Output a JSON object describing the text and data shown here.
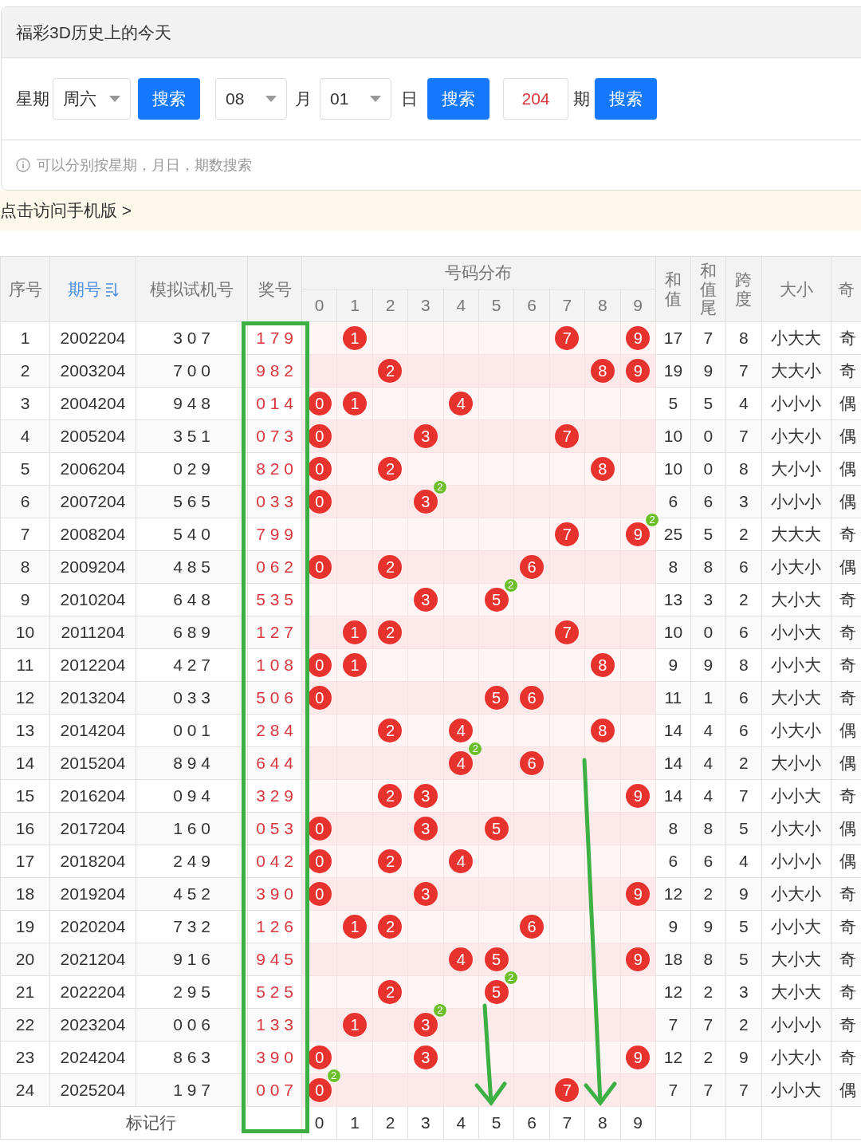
{
  "page_title": "福彩3D历史上的今天",
  "search": {
    "weekday_label": "星期",
    "weekday": "周六",
    "weekday_button": "搜索",
    "month": "08",
    "month_label": "月",
    "day": "01",
    "day_label": "日",
    "date_button": "搜索",
    "issue": "204",
    "issue_label": "期",
    "issue_button": "搜索"
  },
  "hint": "可以分别按星期，月日，期数搜索",
  "mobile_link": "点击访问手机版 >",
  "table": {
    "columns": [
      {
        "label": "序号",
        "sorted": false
      },
      {
        "label": "期号",
        "sorted": true
      },
      {
        "label": "模拟试机号",
        "sorted": false
      },
      {
        "label": "奖号",
        "sorted": false
      }
    ],
    "distribution_title": "号码分布",
    "distribution_columns": [
      "0",
      "1",
      "2",
      "3",
      "4",
      "5",
      "6",
      "7",
      "8",
      "9"
    ],
    "stat_columns": [
      {
        "label": "和值",
        "kind": "stacked"
      },
      {
        "label": "和值尾",
        "kind": "stacked"
      },
      {
        "label": "跨度",
        "kind": "stacked"
      },
      {
        "label": "大小",
        "kind": "plain"
      },
      {
        "label": "奇",
        "kind": "plain"
      }
    ],
    "rows": [
      {
        "seq": "1",
        "issue": "2002204",
        "test": "3 0 7",
        "prize": "1 7 9",
        "cells": [
          null,
          {
            "digit": "1"
          },
          null,
          null,
          null,
          null,
          null,
          {
            "digit": "7"
          },
          null,
          {
            "digit": "9"
          }
        ],
        "sum": "17",
        "sum_tail": "7",
        "span": "8",
        "size": "小大大",
        "parity": "奇"
      },
      {
        "seq": "2",
        "issue": "2003204",
        "test": "7 0 0",
        "prize": "9 8 2",
        "cells": [
          null,
          null,
          {
            "digit": "2"
          },
          null,
          null,
          null,
          null,
          null,
          {
            "digit": "8"
          },
          {
            "digit": "9"
          }
        ],
        "sum": "19",
        "sum_tail": "9",
        "span": "7",
        "size": "大大小",
        "parity": "奇"
      },
      {
        "seq": "3",
        "issue": "2004204",
        "test": "9 4 8",
        "prize": "0 1 4",
        "cells": [
          {
            "digit": "0"
          },
          {
            "digit": "1"
          },
          null,
          null,
          {
            "digit": "4"
          },
          null,
          null,
          null,
          null,
          null
        ],
        "sum": "5",
        "sum_tail": "5",
        "span": "4",
        "size": "小小小",
        "parity": "偶"
      },
      {
        "seq": "4",
        "issue": "2005204",
        "test": "3 5 1",
        "prize": "0 7 3",
        "cells": [
          {
            "digit": "0"
          },
          null,
          null,
          {
            "digit": "3"
          },
          null,
          null,
          null,
          {
            "digit": "7"
          },
          null,
          null
        ],
        "sum": "10",
        "sum_tail": "0",
        "span": "7",
        "size": "小大小",
        "parity": "偶"
      },
      {
        "seq": "5",
        "issue": "2006204",
        "test": "0 2 9",
        "prize": "8 2 0",
        "cells": [
          {
            "digit": "0"
          },
          null,
          {
            "digit": "2"
          },
          null,
          null,
          null,
          null,
          null,
          {
            "digit": "8"
          },
          null
        ],
        "sum": "10",
        "sum_tail": "0",
        "span": "8",
        "size": "大小小",
        "parity": "偶"
      },
      {
        "seq": "6",
        "issue": "2007204",
        "test": "5 6 5",
        "prize": "0 3 3",
        "cells": [
          {
            "digit": "0"
          },
          null,
          null,
          {
            "digit": "3",
            "badge": "2"
          },
          null,
          null,
          null,
          null,
          null,
          null
        ],
        "sum": "6",
        "sum_tail": "6",
        "span": "3",
        "size": "小小小",
        "parity": "偶"
      },
      {
        "seq": "7",
        "issue": "2008204",
        "test": "5 4 0",
        "prize": "7 9 9",
        "cells": [
          null,
          null,
          null,
          null,
          null,
          null,
          null,
          {
            "digit": "7"
          },
          null,
          {
            "digit": "9",
            "badge": "2"
          }
        ],
        "sum": "25",
        "sum_tail": "5",
        "span": "2",
        "size": "大大大",
        "parity": "奇"
      },
      {
        "seq": "8",
        "issue": "2009204",
        "test": "4 8 5",
        "prize": "0 6 2",
        "cells": [
          {
            "digit": "0"
          },
          null,
          {
            "digit": "2"
          },
          null,
          null,
          null,
          {
            "digit": "6"
          },
          null,
          null,
          null
        ],
        "sum": "8",
        "sum_tail": "8",
        "span": "6",
        "size": "小大小",
        "parity": "偶"
      },
      {
        "seq": "9",
        "issue": "2010204",
        "test": "6 4 8",
        "prize": "5 3 5",
        "cells": [
          null,
          null,
          null,
          {
            "digit": "3"
          },
          null,
          {
            "digit": "5",
            "badge": "2"
          },
          null,
          null,
          null,
          null
        ],
        "sum": "13",
        "sum_tail": "3",
        "span": "2",
        "size": "大小大",
        "parity": "奇"
      },
      {
        "seq": "10",
        "issue": "2011204",
        "test": "6 8 9",
        "prize": "1 2 7",
        "cells": [
          null,
          {
            "digit": "1"
          },
          {
            "digit": "2"
          },
          null,
          null,
          null,
          null,
          {
            "digit": "7"
          },
          null,
          null
        ],
        "sum": "10",
        "sum_tail": "0",
        "span": "6",
        "size": "小小大",
        "parity": "奇"
      },
      {
        "seq": "11",
        "issue": "2012204",
        "test": "4 2 7",
        "prize": "1 0 8",
        "cells": [
          {
            "digit": "0"
          },
          {
            "digit": "1"
          },
          null,
          null,
          null,
          null,
          null,
          null,
          {
            "digit": "8"
          },
          null
        ],
        "sum": "9",
        "sum_tail": "9",
        "span": "8",
        "size": "小小大",
        "parity": "奇"
      },
      {
        "seq": "12",
        "issue": "2013204",
        "test": "0 3 3",
        "prize": "5 0 6",
        "cells": [
          {
            "digit": "0"
          },
          null,
          null,
          null,
          null,
          {
            "digit": "5"
          },
          {
            "digit": "6"
          },
          null,
          null,
          null
        ],
        "sum": "11",
        "sum_tail": "1",
        "span": "6",
        "size": "大小大",
        "parity": "奇"
      },
      {
        "seq": "13",
        "issue": "2014204",
        "test": "0 0 1",
        "prize": "2 8 4",
        "cells": [
          null,
          null,
          {
            "digit": "2"
          },
          null,
          {
            "digit": "4"
          },
          null,
          null,
          null,
          {
            "digit": "8"
          },
          null
        ],
        "sum": "14",
        "sum_tail": "4",
        "span": "6",
        "size": "小大小",
        "parity": "偶"
      },
      {
        "seq": "14",
        "issue": "2015204",
        "test": "8 9 4",
        "prize": "6 4 4",
        "cells": [
          null,
          null,
          null,
          null,
          {
            "digit": "4",
            "badge": "2"
          },
          null,
          {
            "digit": "6"
          },
          null,
          null,
          null
        ],
        "sum": "14",
        "sum_tail": "4",
        "span": "2",
        "size": "大小小",
        "parity": "偶"
      },
      {
        "seq": "15",
        "issue": "2016204",
        "test": "0 9 4",
        "prize": "3 2 9",
        "cells": [
          null,
          null,
          {
            "digit": "2"
          },
          {
            "digit": "3"
          },
          null,
          null,
          null,
          null,
          null,
          {
            "digit": "9"
          }
        ],
        "sum": "14",
        "sum_tail": "4",
        "span": "7",
        "size": "小小大",
        "parity": "奇"
      },
      {
        "seq": "16",
        "issue": "2017204",
        "test": "1 6 0",
        "prize": "0 5 3",
        "cells": [
          {
            "digit": "0"
          },
          null,
          null,
          {
            "digit": "3"
          },
          null,
          {
            "digit": "5"
          },
          null,
          null,
          null,
          null
        ],
        "sum": "8",
        "sum_tail": "8",
        "span": "5",
        "size": "小大小",
        "parity": "偶"
      },
      {
        "seq": "17",
        "issue": "2018204",
        "test": "2 4 9",
        "prize": "0 4 2",
        "cells": [
          {
            "digit": "0"
          },
          null,
          {
            "digit": "2"
          },
          null,
          {
            "digit": "4"
          },
          null,
          null,
          null,
          null,
          null
        ],
        "sum": "6",
        "sum_tail": "6",
        "span": "4",
        "size": "小小小",
        "parity": "偶"
      },
      {
        "seq": "18",
        "issue": "2019204",
        "test": "4 5 2",
        "prize": "3 9 0",
        "cells": [
          {
            "digit": "0"
          },
          null,
          null,
          {
            "digit": "3"
          },
          null,
          null,
          null,
          null,
          null,
          {
            "digit": "9"
          }
        ],
        "sum": "12",
        "sum_tail": "2",
        "span": "9",
        "size": "小大小",
        "parity": "奇"
      },
      {
        "seq": "19",
        "issue": "2020204",
        "test": "7 3 2",
        "prize": "1 2 6",
        "cells": [
          null,
          {
            "digit": "1"
          },
          {
            "digit": "2"
          },
          null,
          null,
          null,
          {
            "digit": "6"
          },
          null,
          null,
          null
        ],
        "sum": "9",
        "sum_tail": "9",
        "span": "5",
        "size": "小小大",
        "parity": "奇"
      },
      {
        "seq": "20",
        "issue": "2021204",
        "test": "9 1 6",
        "prize": "9 4 5",
        "cells": [
          null,
          null,
          null,
          null,
          {
            "digit": "4"
          },
          {
            "digit": "5"
          },
          null,
          null,
          null,
          {
            "digit": "9"
          }
        ],
        "sum": "18",
        "sum_tail": "8",
        "span": "5",
        "size": "大小大",
        "parity": "奇"
      },
      {
        "seq": "21",
        "issue": "2022204",
        "test": "2 9 5",
        "prize": "5 2 5",
        "cells": [
          null,
          null,
          {
            "digit": "2"
          },
          null,
          null,
          {
            "digit": "5",
            "badge": "2"
          },
          null,
          null,
          null,
          null
        ],
        "sum": "12",
        "sum_tail": "2",
        "span": "3",
        "size": "大小大",
        "parity": "奇"
      },
      {
        "seq": "22",
        "issue": "2023204",
        "test": "0 0 6",
        "prize": "1 3 3",
        "cells": [
          null,
          {
            "digit": "1"
          },
          null,
          {
            "digit": "3",
            "badge": "2"
          },
          null,
          null,
          null,
          null,
          null,
          null
        ],
        "sum": "7",
        "sum_tail": "7",
        "span": "2",
        "size": "小小小",
        "parity": "奇"
      },
      {
        "seq": "23",
        "issue": "2024204",
        "test": "8 6 3",
        "prize": "3 9 0",
        "cells": [
          {
            "digit": "0"
          },
          null,
          null,
          {
            "digit": "3"
          },
          null,
          null,
          null,
          null,
          null,
          {
            "digit": "9"
          }
        ],
        "sum": "12",
        "sum_tail": "2",
        "span": "9",
        "size": "小大小",
        "parity": "奇"
      },
      {
        "seq": "24",
        "issue": "2025204",
        "test": "1 9 7",
        "prize": "0 0 7",
        "cells": [
          {
            "digit": "0",
            "badge": "2"
          },
          null,
          null,
          null,
          null,
          null,
          null,
          {
            "digit": "7"
          },
          null,
          null
        ],
        "sum": "7",
        "sum_tail": "7",
        "span": "7",
        "size": "小小大",
        "parity": "偶"
      }
    ],
    "footer": {
      "label": "标记行",
      "digits": [
        "0",
        "1",
        "2",
        "3",
        "4",
        "5",
        "6",
        "7",
        "8",
        "9"
      ]
    }
  }
}
